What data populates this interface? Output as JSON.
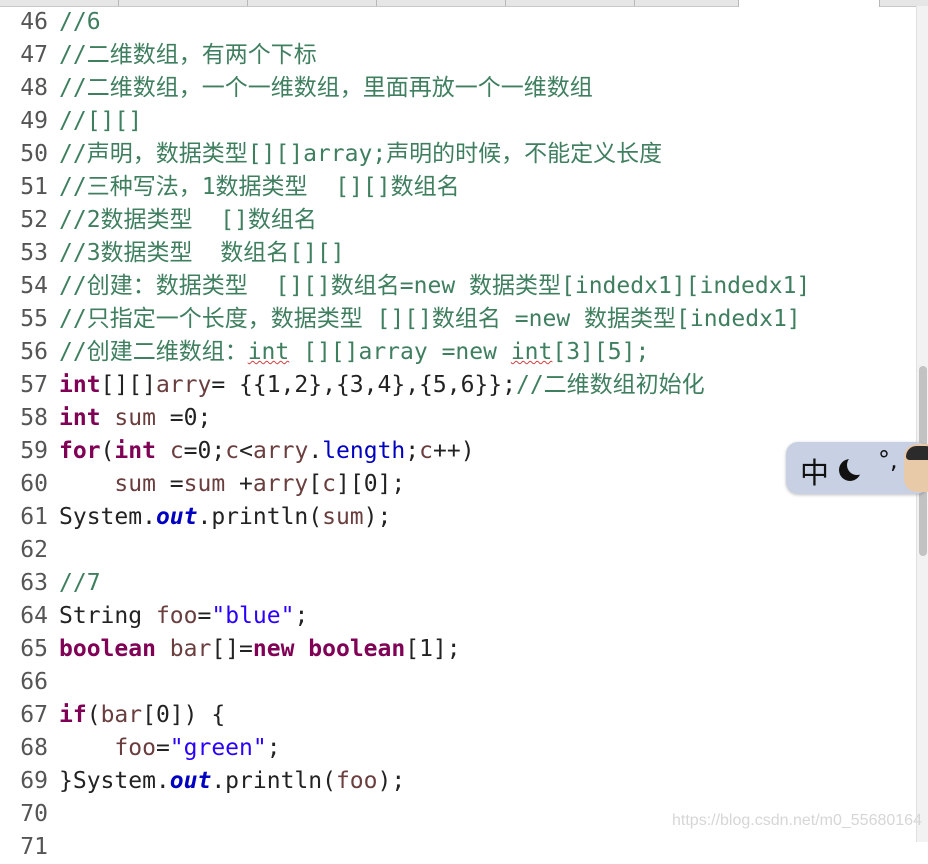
{
  "editor": {
    "lines": [
      {
        "n": "46",
        "tokens": [
          {
            "t": "//6",
            "c": "cm"
          }
        ]
      },
      {
        "n": "47",
        "tokens": [
          {
            "t": "//二维数组，有两个下标",
            "c": "cm"
          }
        ]
      },
      {
        "n": "48",
        "tokens": [
          {
            "t": "//二维数组，一个一维数组，里面再放一个一维数组",
            "c": "cm"
          }
        ]
      },
      {
        "n": "49",
        "tokens": [
          {
            "t": "//[][]",
            "c": "cm"
          }
        ]
      },
      {
        "n": "50",
        "tokens": [
          {
            "t": "//声明，数据类型[][]array;声明的时候，不能定义长度",
            "c": "cm"
          }
        ]
      },
      {
        "n": "51",
        "tokens": [
          {
            "t": "//三种写法，1数据类型  [][]数组名",
            "c": "cm"
          }
        ]
      },
      {
        "n": "52",
        "tokens": [
          {
            "t": "//2数据类型  []数组名",
            "c": "cm"
          }
        ]
      },
      {
        "n": "53",
        "tokens": [
          {
            "t": "//3数据类型  数组名[][]",
            "c": "cm"
          }
        ]
      },
      {
        "n": "54",
        "tokens": [
          {
            "t": "//创建：数据类型  [][]数组名=new 数据类型[indedx1][indedx1]",
            "c": "cm"
          }
        ]
      },
      {
        "n": "55",
        "tokens": [
          {
            "t": "//只指定一个长度，数据类型 [][]数组名 =new 数据类型[indedx1]",
            "c": "cm"
          }
        ]
      },
      {
        "n": "56",
        "tokens": [
          {
            "t": "//创建二维数组：",
            "c": "cm"
          },
          {
            "t": "int",
            "c": "cm sq"
          },
          {
            "t": " [][]array =new ",
            "c": "cm"
          },
          {
            "t": "int",
            "c": "cm sq"
          },
          {
            "t": "[3][5];",
            "c": "cm"
          }
        ]
      },
      {
        "n": "57",
        "tokens": [
          {
            "t": "int",
            "c": "kw"
          },
          {
            "t": "[][]",
            "c": ""
          },
          {
            "t": "arry",
            "c": "varc"
          },
          {
            "t": "= {{1,2},{3,4},{5,6}};",
            "c": ""
          },
          {
            "t": "//二维数组初始化",
            "c": "cm"
          }
        ]
      },
      {
        "n": "58",
        "tokens": [
          {
            "t": "int",
            "c": "kw"
          },
          {
            "t": " ",
            "c": ""
          },
          {
            "t": "sum",
            "c": "varc"
          },
          {
            "t": " =0;",
            "c": ""
          }
        ]
      },
      {
        "n": "59",
        "tokens": [
          {
            "t": "for",
            "c": "kw"
          },
          {
            "t": "(",
            "c": ""
          },
          {
            "t": "int",
            "c": "kw"
          },
          {
            "t": " ",
            "c": ""
          },
          {
            "t": "c",
            "c": "varc"
          },
          {
            "t": "=0;",
            "c": ""
          },
          {
            "t": "c",
            "c": "varc"
          },
          {
            "t": "<",
            "c": ""
          },
          {
            "t": "arry",
            "c": "varc"
          },
          {
            "t": ".",
            "c": ""
          },
          {
            "t": "length",
            "c": "mth"
          },
          {
            "t": ";",
            "c": ""
          },
          {
            "t": "c",
            "c": "varc"
          },
          {
            "t": "++)",
            "c": ""
          }
        ]
      },
      {
        "n": "60",
        "tokens": [
          {
            "t": "    ",
            "c": ""
          },
          {
            "t": "sum",
            "c": "varc"
          },
          {
            "t": " =",
            "c": ""
          },
          {
            "t": "sum",
            "c": "varc"
          },
          {
            "t": " +",
            "c": ""
          },
          {
            "t": "arry",
            "c": "varc"
          },
          {
            "t": "[",
            "c": ""
          },
          {
            "t": "c",
            "c": "varc"
          },
          {
            "t": "][0];",
            "c": ""
          }
        ]
      },
      {
        "n": "61",
        "tokens": [
          {
            "t": "System.",
            "c": ""
          },
          {
            "t": "out",
            "c": "fld"
          },
          {
            "t": ".println(",
            "c": ""
          },
          {
            "t": "sum",
            "c": "varc"
          },
          {
            "t": ");",
            "c": ""
          }
        ]
      },
      {
        "n": "62",
        "tokens": []
      },
      {
        "n": "63",
        "tokens": [
          {
            "t": "//7",
            "c": "cm"
          }
        ]
      },
      {
        "n": "64",
        "tokens": [
          {
            "t": "String ",
            "c": ""
          },
          {
            "t": "foo",
            "c": "varc"
          },
          {
            "t": "=",
            "c": ""
          },
          {
            "t": "\"blue\"",
            "c": "str"
          },
          {
            "t": ";",
            "c": ""
          }
        ]
      },
      {
        "n": "65",
        "tokens": [
          {
            "t": "boolean",
            "c": "kw"
          },
          {
            "t": " ",
            "c": ""
          },
          {
            "t": "bar",
            "c": "varc"
          },
          {
            "t": "[]=",
            "c": ""
          },
          {
            "t": "new",
            "c": "kw"
          },
          {
            "t": " ",
            "c": ""
          },
          {
            "t": "boolean",
            "c": "kw"
          },
          {
            "t": "[1];",
            "c": ""
          }
        ]
      },
      {
        "n": "66",
        "tokens": []
      },
      {
        "n": "67",
        "tokens": [
          {
            "t": "if",
            "c": "kw"
          },
          {
            "t": "(",
            "c": ""
          },
          {
            "t": "bar",
            "c": "varc"
          },
          {
            "t": "[0]) {",
            "c": ""
          }
        ]
      },
      {
        "n": "68",
        "tokens": [
          {
            "t": "    ",
            "c": ""
          },
          {
            "t": "foo",
            "c": "varc"
          },
          {
            "t": "=",
            "c": ""
          },
          {
            "t": "\"green\"",
            "c": "str"
          },
          {
            "t": ";",
            "c": ""
          }
        ]
      },
      {
        "n": "69",
        "tokens": [
          {
            "t": "}System.",
            "c": ""
          },
          {
            "t": "out",
            "c": "fld"
          },
          {
            "t": ".println(",
            "c": ""
          },
          {
            "t": "foo",
            "c": "varc"
          },
          {
            "t": ");",
            "c": ""
          }
        ]
      },
      {
        "n": "70",
        "tokens": []
      },
      {
        "n": "71",
        "tokens": []
      }
    ]
  },
  "ime": {
    "mode": "中",
    "icon": "moon-icon",
    "punct": "°,"
  },
  "watermark": "https://blog.csdn.net/m0_55680164",
  "colors": {
    "comment": "#3f7f5f",
    "keyword": "#7f0055",
    "string": "#2a00ff",
    "field": "#0000c0",
    "variable": "#6a3e3e"
  }
}
